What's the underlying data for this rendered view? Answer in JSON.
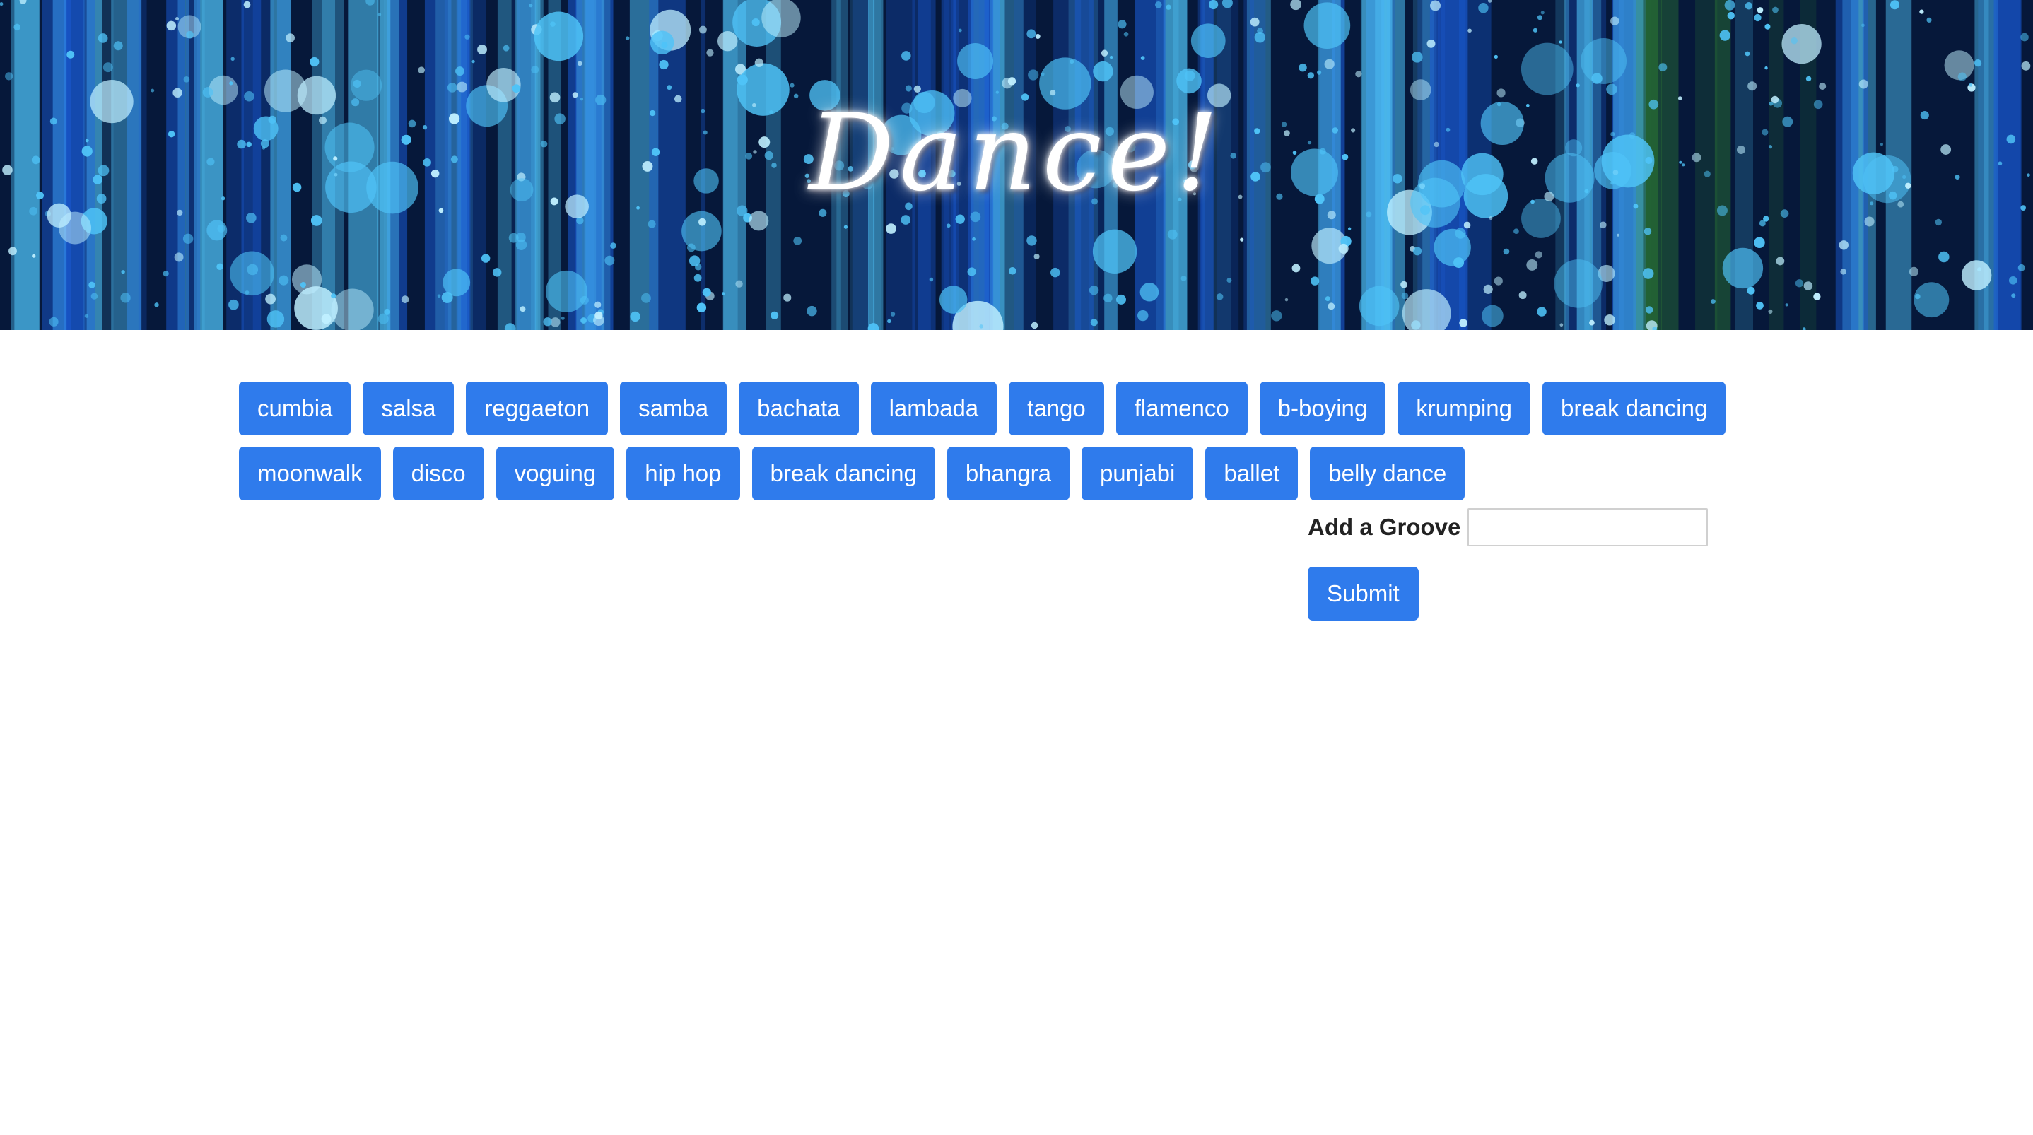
{
  "header": {
    "title": "Dance!",
    "background_colors": [
      "#06183a",
      "#1a5bd6",
      "#4fc3f7",
      "#2e7d32"
    ]
  },
  "dances": {
    "row1": [
      "cumbia",
      "salsa",
      "reggaeton",
      "samba",
      "bachata",
      "lambada",
      "tango",
      "flamenco",
      "b-boying",
      "krumping",
      "break dancing"
    ],
    "row2": [
      "moonwalk",
      "disco",
      "voguing",
      "hip hop",
      "break dancing",
      "bhangra",
      "punjabi",
      "ballet",
      "belly dance"
    ]
  },
  "form": {
    "label": "Add a Groove",
    "input_value": "",
    "submit_label": "Submit"
  },
  "colors": {
    "button": "#2f7bec",
    "button_text": "#ffffff"
  }
}
